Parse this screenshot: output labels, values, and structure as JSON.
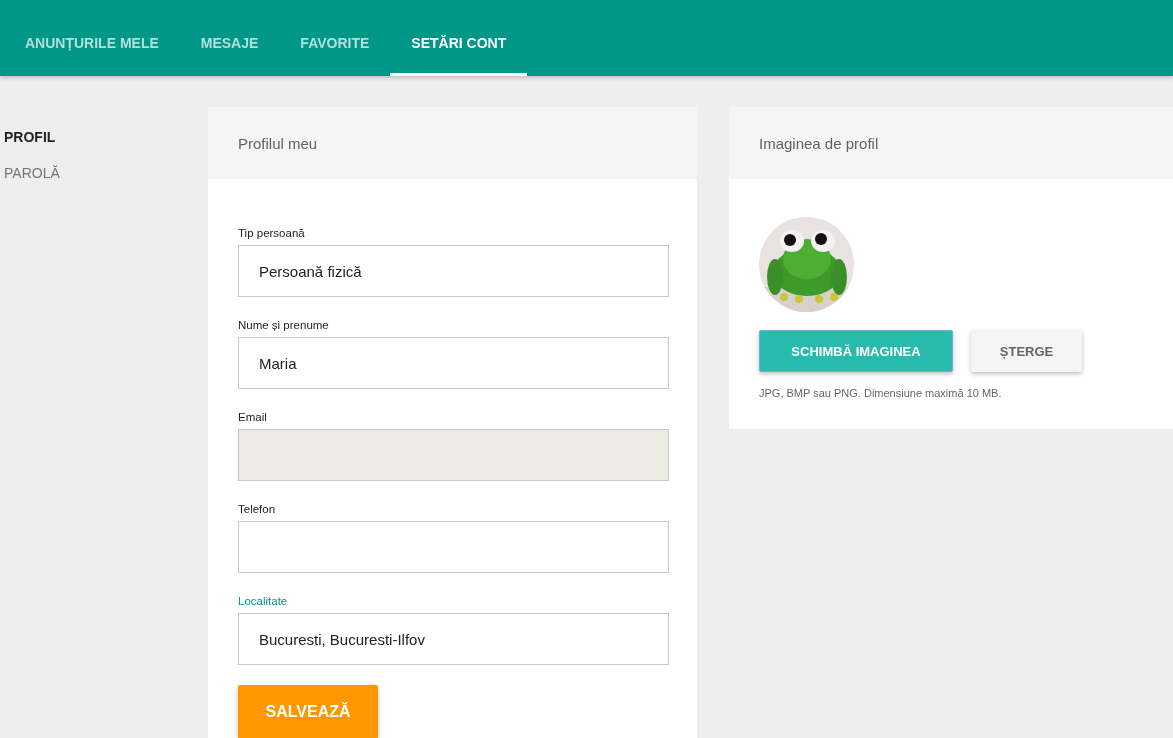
{
  "tabs": [
    {
      "label": "ANUNȚURILE MELE",
      "selected": false
    },
    {
      "label": "MESAJE",
      "selected": false
    },
    {
      "label": "FAVORITE",
      "selected": false
    },
    {
      "label": "SETĂRI CONT",
      "selected": true
    }
  ],
  "sidebar": {
    "items": [
      {
        "label": "PROFIL",
        "selected": true
      },
      {
        "label": "PAROLĂ",
        "selected": false
      }
    ]
  },
  "profile_card": {
    "title": "Profilul meu",
    "fields": [
      {
        "label": "Tip persoană",
        "value": "Persoană fizică",
        "disabled": false,
        "focused": false
      },
      {
        "label": "Nume și prenume",
        "value": "Maria",
        "disabled": false,
        "focused": false
      },
      {
        "label": "Email",
        "disabled": true,
        "focused": false
      },
      {
        "label": "Telefon",
        "disabled": false,
        "focused": false
      },
      {
        "label": "Localitate",
        "value": "Bucuresti, Bucuresti-Ilfov",
        "disabled": false,
        "focused": true
      }
    ],
    "save_button": "SALVEAZĂ"
  },
  "image_card": {
    "title": "Imaginea de profil",
    "buttons": [
      {
        "label": "SCHIMBĂ IMAGINEA",
        "kind": "primary"
      },
      {
        "label": "ȘTERGE",
        "kind": "secondary"
      }
    ],
    "hint": "JPG, BMP sau PNG. Dimensiune maximă 10 MB."
  }
}
